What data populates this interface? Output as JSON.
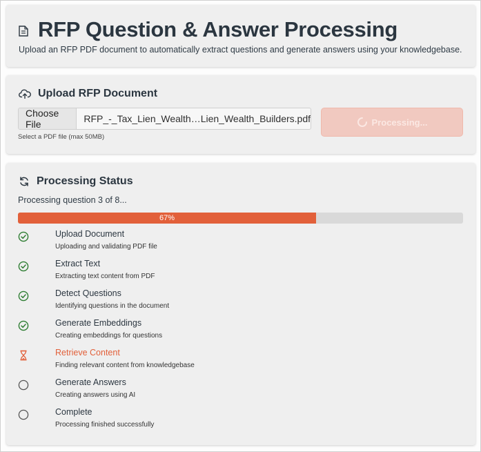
{
  "header": {
    "title": "RFP Question & Answer Processing",
    "subtitle": "Upload an RFP PDF document to automatically extract questions and generate answers using your knowledgebase.",
    "icon": "document-icon"
  },
  "upload": {
    "title": "Upload RFP Document",
    "icon": "cloud-upload-icon",
    "choose_label": "Choose File",
    "file_name": "RFP_-_Tax_Lien_Wealth…Lien_Wealth_Builders.pdf",
    "help_text": "Select a PDF file (max 50MB)",
    "process_label": "Processing...",
    "process_icon": "spinner-icon"
  },
  "status": {
    "title": "Processing Status",
    "icon": "refresh-icon",
    "message": "Processing question 3 of 8...",
    "progress": 0.67,
    "progress_label": "67%",
    "steps": [
      {
        "label": "Upload Document",
        "desc": "Uploading and validating PDF file",
        "state": "done",
        "icon": "check-circle-icon"
      },
      {
        "label": "Extract Text",
        "desc": "Extracting text content from PDF",
        "state": "done",
        "icon": "check-circle-icon"
      },
      {
        "label": "Detect Questions",
        "desc": "Identifying questions in the document",
        "state": "done",
        "icon": "check-circle-icon"
      },
      {
        "label": "Generate Embeddings",
        "desc": "Creating embeddings for questions",
        "state": "done",
        "icon": "check-circle-icon"
      },
      {
        "label": "Retrieve Content",
        "desc": "Finding relevant content from knowledgebase",
        "state": "active",
        "icon": "hourglass-icon"
      },
      {
        "label": "Generate Answers",
        "desc": "Creating answers using AI",
        "state": "pending",
        "icon": "empty-circle-icon"
      },
      {
        "label": "Complete",
        "desc": "Processing finished successfully",
        "state": "pending",
        "icon": "empty-circle-icon"
      }
    ]
  },
  "colors": {
    "accent": "#e2603a",
    "done": "#2e7d32",
    "pending": "#555555",
    "card_bg": "#efefef"
  }
}
